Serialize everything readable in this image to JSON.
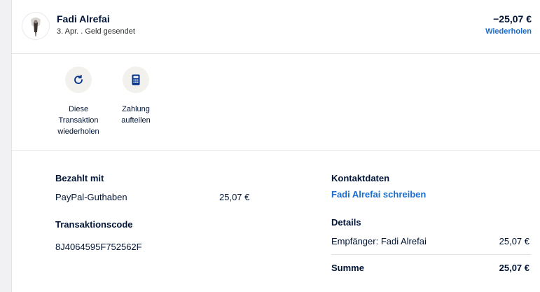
{
  "transaction": {
    "name": "Fadi Alrefai",
    "subtitle": "3. Apr. . Geld gesendet",
    "amount": "−25,07 €",
    "repeat_link": "Wiederholen"
  },
  "actions": [
    {
      "label": "Diese\nTransaktion\nwiederholen",
      "icon": "refresh-icon"
    },
    {
      "label": "Zahlung\naufteilen",
      "icon": "calculator-icon"
    }
  ],
  "payment": {
    "heading": "Bezahlt mit",
    "method": "PayPal-Guthaben",
    "method_amount": "25,07 €",
    "code_heading": "Transaktionscode",
    "code": "8J4064595F752562F"
  },
  "contact": {
    "heading": "Kontaktdaten",
    "write_link": "Fadi Alrefai schreiben"
  },
  "details": {
    "heading": "Details",
    "recipient_label": "Empfänger: Fadi Alrefai",
    "recipient_amount": "25,07 €",
    "sum_label": "Summe",
    "sum_amount": "25,07 €"
  },
  "colors": {
    "link": "#1a6dd0",
    "text": "#001435",
    "icon_bg": "#f2f1ee"
  }
}
